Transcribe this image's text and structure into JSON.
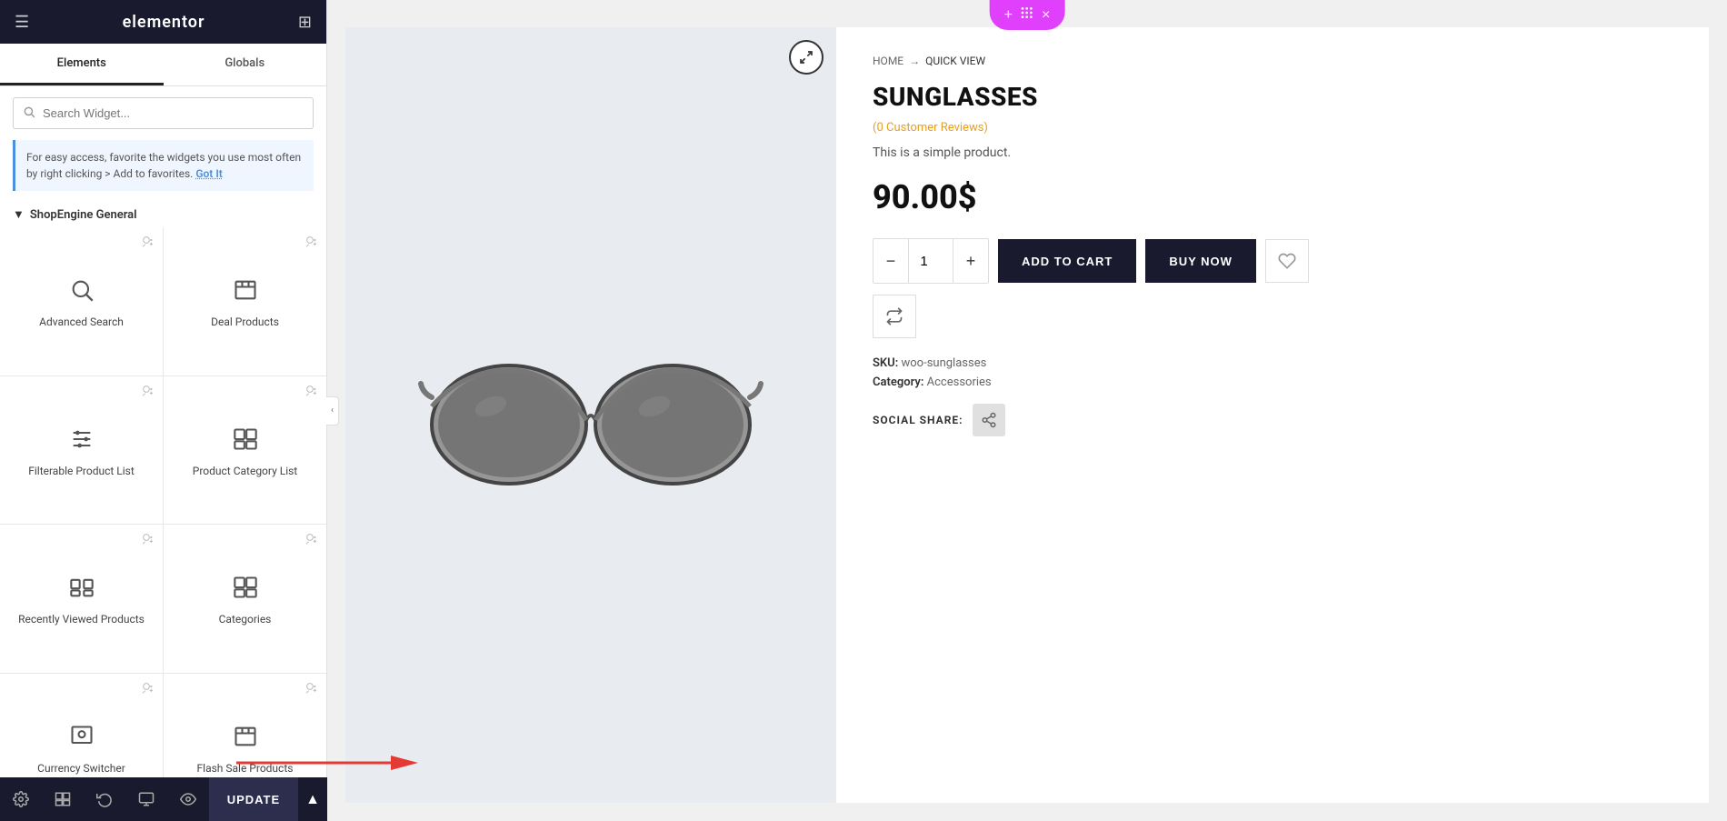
{
  "sidebar": {
    "header": {
      "logo": "elementor",
      "hamburger": "☰",
      "grid": "⊞"
    },
    "tabs": [
      {
        "label": "Elements",
        "active": true
      },
      {
        "label": "Globals",
        "active": false
      }
    ],
    "search": {
      "placeholder": "Search Widget..."
    },
    "infoBanner": {
      "text": "For easy access, favorite the widgets you use most often by right clicking > Add to favorites.",
      "linkLabel": "Got It"
    },
    "sectionTitle": "ShopEngine General",
    "widgets": [
      {
        "id": "advanced-search",
        "label": "Advanced Search",
        "icon": "search"
      },
      {
        "id": "deal-products",
        "label": "Deal Products",
        "icon": "archive"
      },
      {
        "id": "filterable-product-list",
        "label": "Filterable Product List",
        "icon": "list"
      },
      {
        "id": "product-category-list",
        "label": "Product Category List",
        "icon": "box"
      },
      {
        "id": "recently-viewed-products",
        "label": "Recently Viewed Products",
        "icon": "layers"
      },
      {
        "id": "categories",
        "label": "Categories",
        "icon": "box2"
      },
      {
        "id": "currency-switcher",
        "label": "Currency Switcher",
        "icon": "camera"
      },
      {
        "id": "flash-sale-products",
        "label": "Flash Sale Products",
        "icon": "archive2"
      }
    ]
  },
  "toolbar": {
    "settingsLabel": "⚙",
    "layersLabel": "⧉",
    "historyLabel": "↺",
    "responsiveLabel": "⬛",
    "previewLabel": "◎",
    "updateLabel": "UPDATE",
    "chevronLabel": "▲"
  },
  "topBar": {
    "addIcon": "+",
    "dotsIcon": "⋯",
    "closeIcon": "×"
  },
  "product": {
    "breadcrumb": {
      "home": "HOME",
      "arrow": "→",
      "current": "QUICK VIEW"
    },
    "title": "SUNGLASSES",
    "reviews": "(0 Customer Reviews)",
    "description": "This is a simple product.",
    "price": "90.00$",
    "quantity": "1",
    "addToCart": "ADD TO CART",
    "buyNow": "BUY NOW",
    "sku": {
      "label": "SKU:",
      "value": "woo-sunglasses"
    },
    "category": {
      "label": "Category:",
      "value": "Accessories"
    },
    "socialShare": "SOCIAL SHARE:"
  }
}
